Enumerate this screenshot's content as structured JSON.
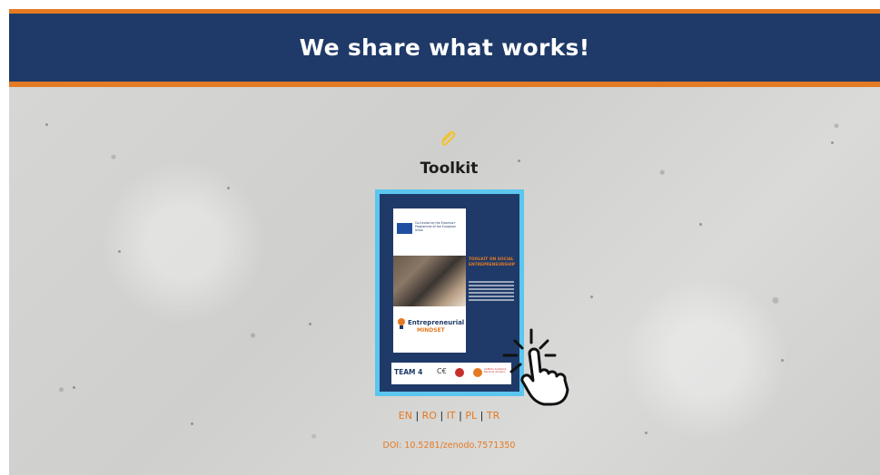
{
  "header": {
    "title": "We share what works!"
  },
  "section": {
    "title": "Toolkit",
    "icon": "paperclip-icon"
  },
  "toolkit_cover": {
    "eu_text": "Co-funded by the Erasmus+ Programme of the European Union",
    "title_text": "TOOLKIT ON SOCIAL ENTREPRENEURSHIP",
    "brand_line1": "Entrepreneurial",
    "brand_line2": "MINDSET",
    "partner_team": "TEAM 4",
    "partner_c": "C€",
    "partner_small": "Instituto Academia Nacional de Apoio"
  },
  "languages": [
    {
      "label": "EN"
    },
    {
      "label": "RO"
    },
    {
      "label": "IT"
    },
    {
      "label": "PL"
    },
    {
      "label": "TR"
    }
  ],
  "separator": "|",
  "doi": "DOI: 10.5281/zenodo.7571350",
  "colors": {
    "navy": "#1f3a68",
    "orange": "#e47a23",
    "cyan": "#5bc6ee"
  }
}
